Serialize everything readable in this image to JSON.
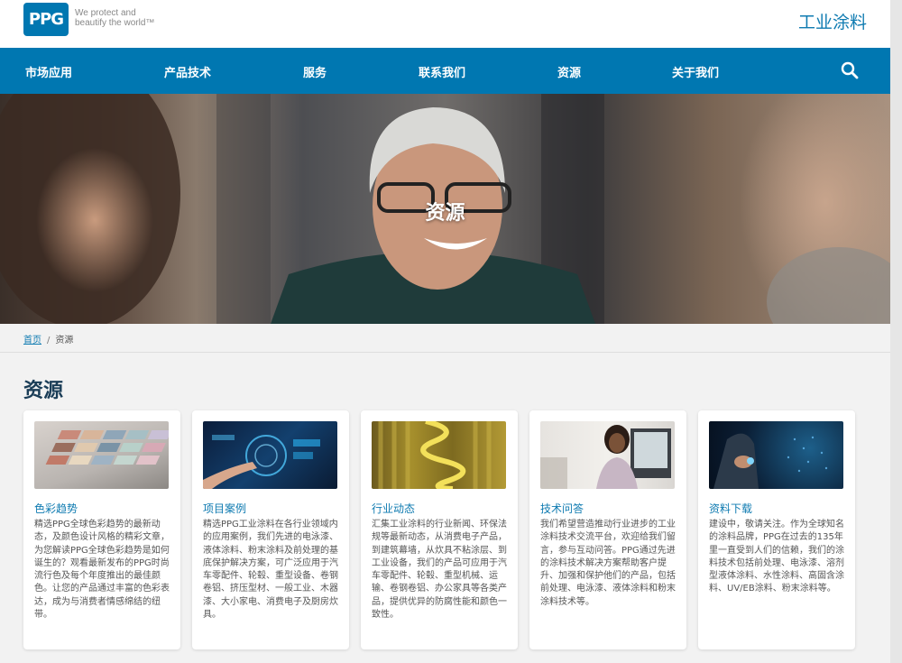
{
  "header": {
    "logo_text": "PPG",
    "tagline_line1": "We protect and",
    "tagline_line2": "beautify the world™",
    "site_name": "工业涂料"
  },
  "nav": {
    "items": [
      "市场应用",
      "产品技术",
      "服务",
      "联系我们",
      "资源",
      "关于我们"
    ]
  },
  "hero": {
    "title": "资源"
  },
  "breadcrumb": {
    "home": "首页",
    "separator": "/",
    "current": "资源"
  },
  "section": {
    "title": "资源"
  },
  "cards": [
    {
      "title": "色彩趋势",
      "icon": "color-swatches-image",
      "desc": "精选PPG全球色彩趋势的最新动态，及颜色设计风格的精彩文章，为您解读PPG全球色彩趋势是如何诞生的？观看最新发布的PPG时尚流行色及每个年度推出的最佳颜色。让您的产品通过丰富的色彩表达，成为与消费者情感绵结的纽带。"
    },
    {
      "title": "项目案例",
      "icon": "tech-touchscreen-image",
      "desc": "精选PPG工业涂料在各行业领域内的应用案例，我们先进的电泳漆、液体涂料、粉末涂料及前处理的基底保护解决方案，可广泛应用于汽车零配件、轮毂、重型设备、卷钢卷铝、挤压型材、一般工业、木器漆、大小家电、消费电子及厨房炊具。"
    },
    {
      "title": "行业动态",
      "icon": "yellow-springs-image",
      "desc": "汇集工业涂料的行业新闻、环保法规等最新动态，从消费电子产品，到建筑幕墙，从炊具不粘涂层、到工业设备，我们的产品可应用于汽车零配件、轮毂、重型机械、运输、卷钢卷铝、办公家具等各类产品，提供优异的防腐性能和颜色一致性。"
    },
    {
      "title": "技术问答",
      "icon": "support-agent-image",
      "desc": "我们希望营造推动行业进步的工业涂料技术交流平台，欢迎给我们留言，参与互动问答。PPG通过先进的涂料技术解决方案帮助客户提升、加强和保护他们的产品，包括前处理、电泳漆、液体涂料和粉末涂料技术等。"
    },
    {
      "title": "资料下载",
      "icon": "digital-touch-image",
      "desc": "建设中，敬请关注。作为全球知名的涂料品牌，PPG在过去的135年里一直受到人们的信赖，我们的涂料技术包括前处理、电泳漆、溶剂型液体涂料、水性涂料、高固含涂料、UV/EB涂料、粉末涂料等。"
    }
  ],
  "colors": {
    "brand_blue": "#0077b1",
    "link_blue": "#0f7bb1",
    "heading": "#1a3d57"
  }
}
